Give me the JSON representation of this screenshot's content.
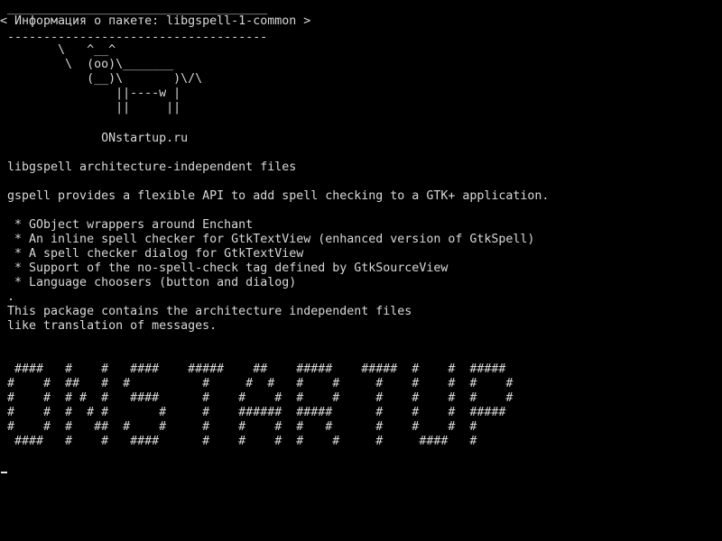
{
  "terminal": {
    "fg_color": "#d8d8d8",
    "bg_color": "#000000",
    "lines": [
      " ____________________________________",
      "< Информация о пакете: libgspell-1-common >",
      " ------------------------------------",
      "        \\   ^__^",
      "         \\  (oo)\\_______",
      "            (__)\\       )\\/\\",
      "                ||----w |",
      "                ||     ||",
      "",
      "              ONstartup.ru",
      "",
      " libgspell architecture-independent files",
      "",
      " gspell provides a flexible API to add spell checking to a GTK+ application.",
      "",
      "  * GObject wrappers around Enchant",
      "  * An inline spell checker for GtkTextView (enhanced version of GtkSpell)",
      "  * A spell checker dialog for GtkTextView",
      "  * Support of the no-spell-check tag defined by GtkSourceView",
      "  * Language choosers (button and dialog)",
      " .",
      " This package contains the architecture independent files",
      " like translation of messages.",
      "",
      "",
      "  ####   #    #   ####    #####    ##    #####    #####  #    #  #####",
      " #    #  ##   #  #          #     #  #   #    #     #    #    #  #    #",
      " #    #  # #  #   ####      #    #    #  #    #     #    #    #  #    #",
      " #    #  #  # #       #     #    ######  #####      #    #    #  #####",
      " #    #  #   ##  #    #     #    #    #  #   #      #    #    #  #",
      "  ####   #    #   ####      #    #    #  #    #     #     ####   #"
    ]
  }
}
